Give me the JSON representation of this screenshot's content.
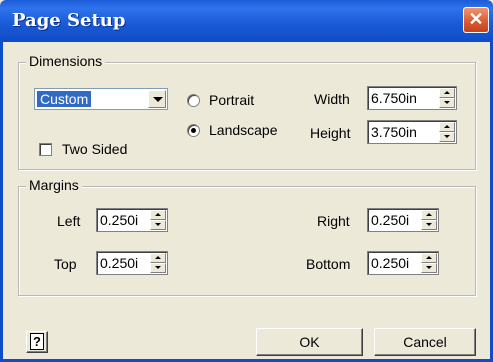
{
  "window": {
    "title": "Page Setup",
    "close_glyph": "✕"
  },
  "dimensions": {
    "label": "Dimensions",
    "paper_size": "Custom",
    "orientation": {
      "portrait": "Portrait",
      "landscape": "Landscape",
      "selected": "landscape"
    },
    "two_sided": {
      "label": "Two Sided",
      "checked": false
    },
    "width": {
      "label": "Width",
      "value": "6.750in"
    },
    "height": {
      "label": "Height",
      "value": "3.750in"
    }
  },
  "margins": {
    "label": "Margins",
    "left": {
      "label": "Left",
      "value": "0.250i"
    },
    "top": {
      "label": "Top",
      "value": "0.250i"
    },
    "right": {
      "label": "Right",
      "value": "0.250i"
    },
    "bottom": {
      "label": "Bottom",
      "value": "0.250i"
    }
  },
  "footer": {
    "help_label": "?",
    "ok_label": "OK",
    "cancel_label": "Cancel"
  },
  "colors": {
    "title_bar": "#1b5bd8",
    "close_button": "#d9582f",
    "dialog_bg": "#ece9d8",
    "selection": "#316ac5"
  }
}
